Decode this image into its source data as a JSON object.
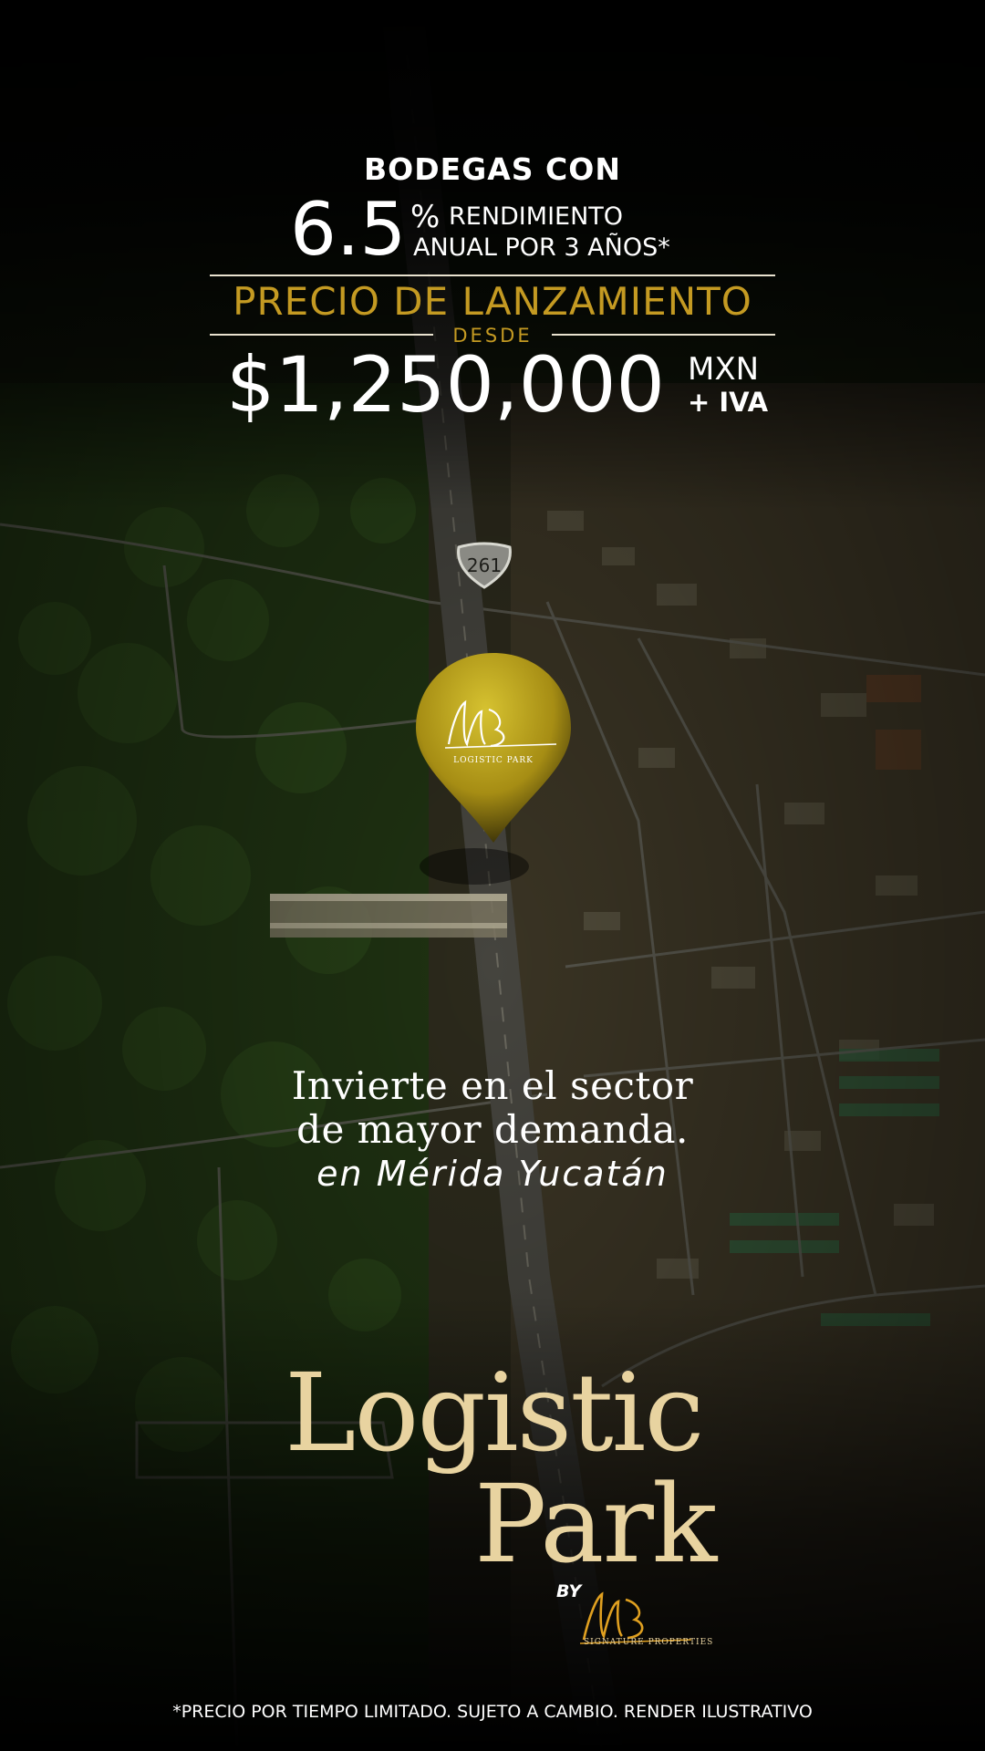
{
  "headline": {
    "eyebrow": "BODEGAS CON",
    "rate_value": "6.5",
    "rate_symbol": "%",
    "rate_line1": "RENDIMIENTO",
    "rate_line2": "ANUAL POR 3 AÑOS*"
  },
  "launch": {
    "title": "PRECIO DE LANZAMIENTO",
    "from_label": "DESDE",
    "price": "$1,250,000",
    "currency": "MXN",
    "tax": "+ IVA"
  },
  "map": {
    "route_shield": "261",
    "pin_logo_caption": "LOGISTIC PARK",
    "pin_icon": "map-pin-icon"
  },
  "tagline": {
    "line1": "Invierte en el sector",
    "line2": "de mayor demanda.",
    "line3": "en Mérida Yucatán"
  },
  "brand": {
    "line1": "Logistic",
    "line2": "Park",
    "by": "BY",
    "signature_caption": "SIGNATURE PROPERTIES"
  },
  "disclaimer": "*PRECIO POR TIEMPO LIMITADO. SUJETO A CAMBIO. RENDER ILUSTRATIVO",
  "colors": {
    "gold": "#c49a22",
    "cream": "#e8d3a0",
    "white": "#ffffff",
    "background": "#000000"
  }
}
